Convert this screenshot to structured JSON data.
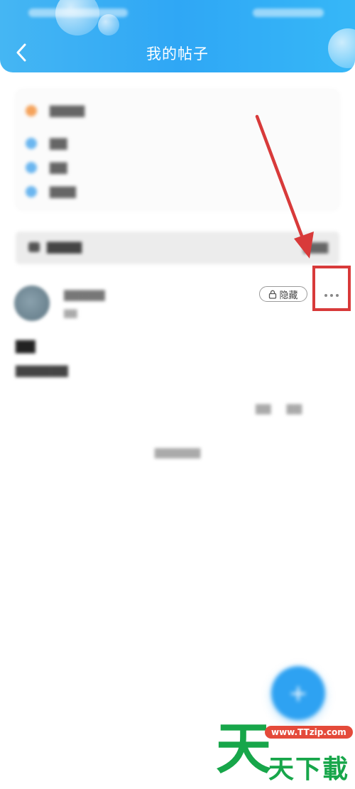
{
  "header": {
    "title": "我的帖子",
    "back_label": "<"
  },
  "info_card": {
    "rows": [
      {
        "label": "▇▇▇▇",
        "color": "#f5a35c"
      },
      {
        "label": "▇▇",
        "color": "#6bb6ef"
      },
      {
        "label": "▇▇",
        "color": "#6bb6ef"
      },
      {
        "label": "▇▇▇",
        "color": "#6bb6ef"
      }
    ]
  },
  "section": {
    "left_label": "▇▇▇▇",
    "right_label": "▇▇▇"
  },
  "post": {
    "author": "▇▇▇▇▇",
    "author_sub": "▇▇",
    "hide_label": "隐藏",
    "title": "▇▇",
    "body": "▇▇▇▇▇▇",
    "actions": [
      "▇▇",
      "▇▇"
    ]
  },
  "footer_note": "▇▇▇▇▇▇",
  "fab": {
    "label": "+"
  },
  "watermark": {
    "logo_char": "天",
    "url": "www.TTzip.com",
    "name": "天下載"
  },
  "colors": {
    "header_blue": "#2fa7f5",
    "annotation_red": "#d83a3a",
    "watermark_green": "#17a64a"
  }
}
